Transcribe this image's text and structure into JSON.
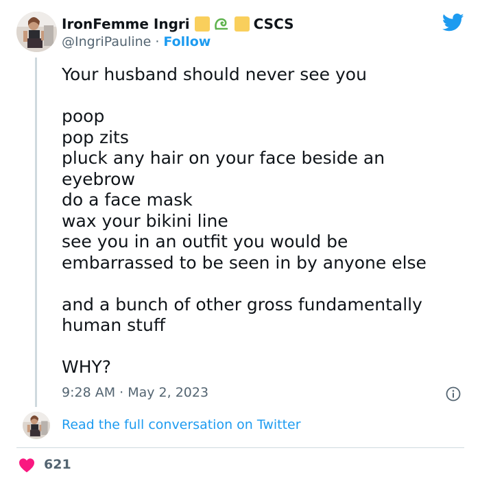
{
  "tweet": {
    "author": {
      "display_name": "IronFemme Ingri",
      "name_suffix": "CSCS",
      "handle": "@IngriPauline",
      "separator": "·",
      "follow_label": "Follow"
    },
    "text": "Your husband should never see you\n\npoop\npop zits\npluck any hair on your face beside an\neyebrow\ndo a face mask\nwax your bikini line\nsee you in an outfit you would be\nembarrassed to be seen in by anyone else\n\nand a bunch of other gross fundamentally\nhuman stuff\n\nWHY?",
    "timestamp": "9:28 AM · May 2, 2023",
    "read_link": "Read the full conversation on Twitter",
    "likes": "621",
    "icons": [
      "twitter-bird-icon",
      "info-icon",
      "heart-icon",
      "emoji-icon"
    ],
    "colors": {
      "brand_blue": "#1d9bf0",
      "heart_pink": "#f91880",
      "secondary_text": "#536471",
      "emoji_yellow": "#f9cf5c",
      "emoji_green": "#5fb34e"
    }
  }
}
